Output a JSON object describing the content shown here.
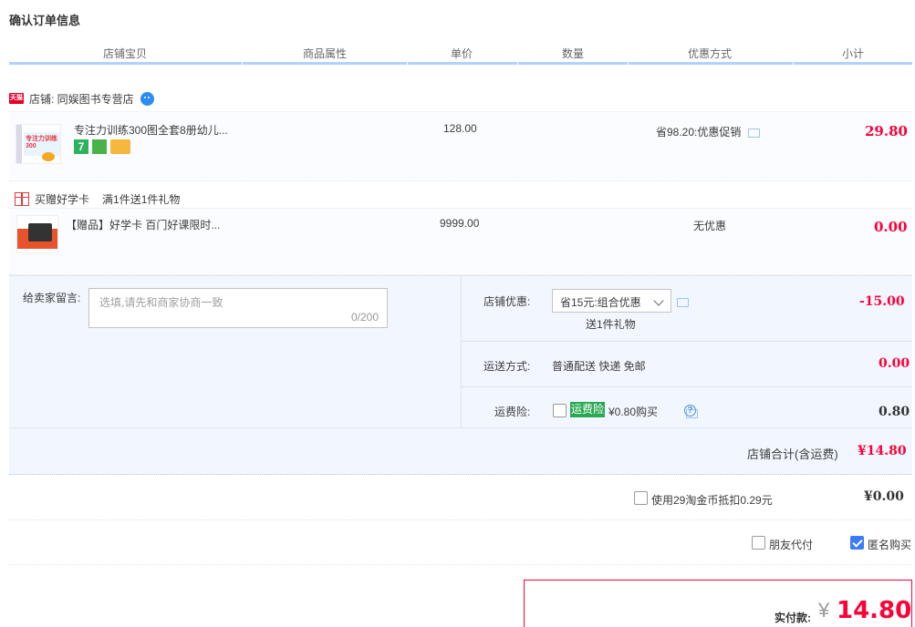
{
  "page_title": "确认订单信息",
  "columns": [
    "店铺宝贝",
    "商品属性",
    "单价",
    "数量",
    "优惠方式",
    "小计"
  ],
  "shop": {
    "badge": "天猫",
    "label": "店铺: 同娱图书专营店"
  },
  "items": [
    {
      "title": "专注力训练300图全套8册幼儿...",
      "thumb_text": "专注力训练300",
      "unit_price": "128.00",
      "promo": "省98.20:优惠促销",
      "subtotal": "29.80"
    },
    {
      "title": "【赠品】好学卡 百门好课限时...",
      "unit_price": "9999.00",
      "promo": "无优惠",
      "subtotal": "0.00"
    }
  ],
  "gift_row": {
    "label": "买赠好学卡",
    "rule": "满1件送1件礼物"
  },
  "message": {
    "label": "给卖家留言:",
    "placeholder": "选填,请先和商家协商一致",
    "counter": "0/200"
  },
  "shop_discount": {
    "label": "店铺优惠:",
    "selected": "省15元:组合优惠",
    "note": "送1件礼物",
    "amount": "-15.00"
  },
  "delivery": {
    "label": "运送方式:",
    "value": "普通配送 快递 免邮",
    "amount": "0.00"
  },
  "insurance": {
    "label": "运费险:",
    "tag": "运费险",
    "price_text": "¥0.80购买",
    "amount": "0.80"
  },
  "shop_total": {
    "label": "店铺合计(含运费)",
    "amount": "¥14.80"
  },
  "coins": {
    "label": "使用29淘金币抵扣0.29元",
    "amount": "¥0.00"
  },
  "options": {
    "friend_pay": "朋友代付",
    "anonymous": "匿名购买"
  },
  "payment": {
    "label": "实付款:",
    "currency": "¥",
    "amount": "14.80"
  },
  "colors": {
    "accent_red": "#ff0036",
    "header_line": "#b2d1ff",
    "panel_bg": "#f2f7ff",
    "checkbox_blue": "#3a7cf5",
    "insurance_green": "#2aa852"
  }
}
